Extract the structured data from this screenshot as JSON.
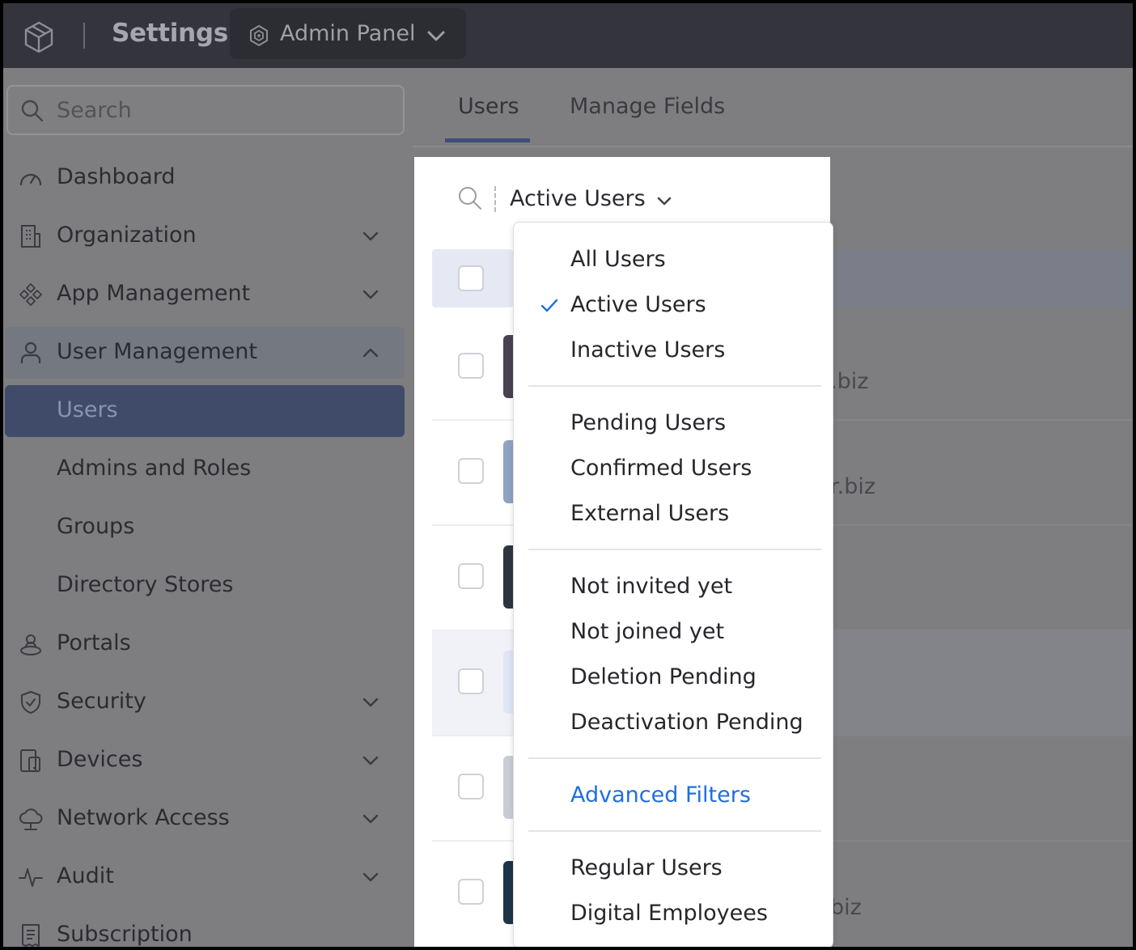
{
  "topbar": {
    "title": "Settings",
    "panel_label": "Admin Panel",
    "icons": [
      "cube-logo-icon",
      "admin-panel-icon",
      "chevron-down-icon"
    ]
  },
  "sidebar": {
    "search_placeholder": "Search",
    "items": [
      {
        "label": "Dashboard",
        "icon": "speedometer-icon",
        "chevron": false,
        "state": "normal"
      },
      {
        "label": "Organization",
        "icon": "building-icon",
        "chevron": "down",
        "state": "normal"
      },
      {
        "label": "App Management",
        "icon": "apps-icon",
        "chevron": "down",
        "state": "normal"
      },
      {
        "label": "User Management",
        "icon": "user-icon",
        "chevron": "up",
        "state": "expanded"
      },
      {
        "label": "Users",
        "icon": null,
        "chevron": false,
        "state": "active"
      },
      {
        "label": "Admins and Roles",
        "icon": null,
        "chevron": false,
        "state": "sub"
      },
      {
        "label": "Groups",
        "icon": null,
        "chevron": false,
        "state": "sub"
      },
      {
        "label": "Directory Stores",
        "icon": null,
        "chevron": false,
        "state": "sub"
      },
      {
        "label": "Portals",
        "icon": "portal-user-icon",
        "chevron": false,
        "state": "normal"
      },
      {
        "label": "Security",
        "icon": "shield-icon",
        "chevron": "down",
        "state": "normal"
      },
      {
        "label": "Devices",
        "icon": "devices-icon",
        "chevron": "down",
        "state": "normal"
      },
      {
        "label": "Network Access",
        "icon": "cloud-network-icon",
        "chevron": "down",
        "state": "normal"
      },
      {
        "label": "Audit",
        "icon": "pulse-icon",
        "chevron": "down",
        "state": "normal"
      },
      {
        "label": "Subscription",
        "icon": "receipt-icon",
        "chevron": false,
        "state": "normal"
      }
    ]
  },
  "main": {
    "tabs": [
      {
        "label": "Users",
        "active": true
      },
      {
        "label": "Manage Fields",
        "active": false
      }
    ],
    "filter": {
      "selected": "Active Users"
    },
    "background_texts": [
      ".biz",
      "r.biz",
      "biz"
    ]
  },
  "dropdown": {
    "groups": [
      [
        {
          "label": "All Users",
          "checked": false
        },
        {
          "label": "Active Users",
          "checked": true
        },
        {
          "label": "Inactive Users",
          "checked": false
        }
      ],
      [
        {
          "label": "Pending Users",
          "checked": false
        },
        {
          "label": "Confirmed Users",
          "checked": false
        },
        {
          "label": "External Users",
          "checked": false
        }
      ],
      [
        {
          "label": "Not invited yet",
          "checked": false
        },
        {
          "label": "Not joined yet",
          "checked": false
        },
        {
          "label": "Deletion Pending",
          "checked": false
        },
        {
          "label": "Deactivation Pending",
          "checked": false
        }
      ],
      [
        {
          "label": "Advanced Filters",
          "link": true
        }
      ],
      [
        {
          "label": "Regular Users",
          "checked": false
        },
        {
          "label": "Digital Employees",
          "checked": false
        }
      ]
    ]
  },
  "colors": {
    "topbar": "#34343c",
    "overlay_gray": "#7e7e80",
    "active_nav": "#404b6a",
    "accent_blue": "#1f6fe0",
    "check_blue": "#1f6fe0"
  }
}
